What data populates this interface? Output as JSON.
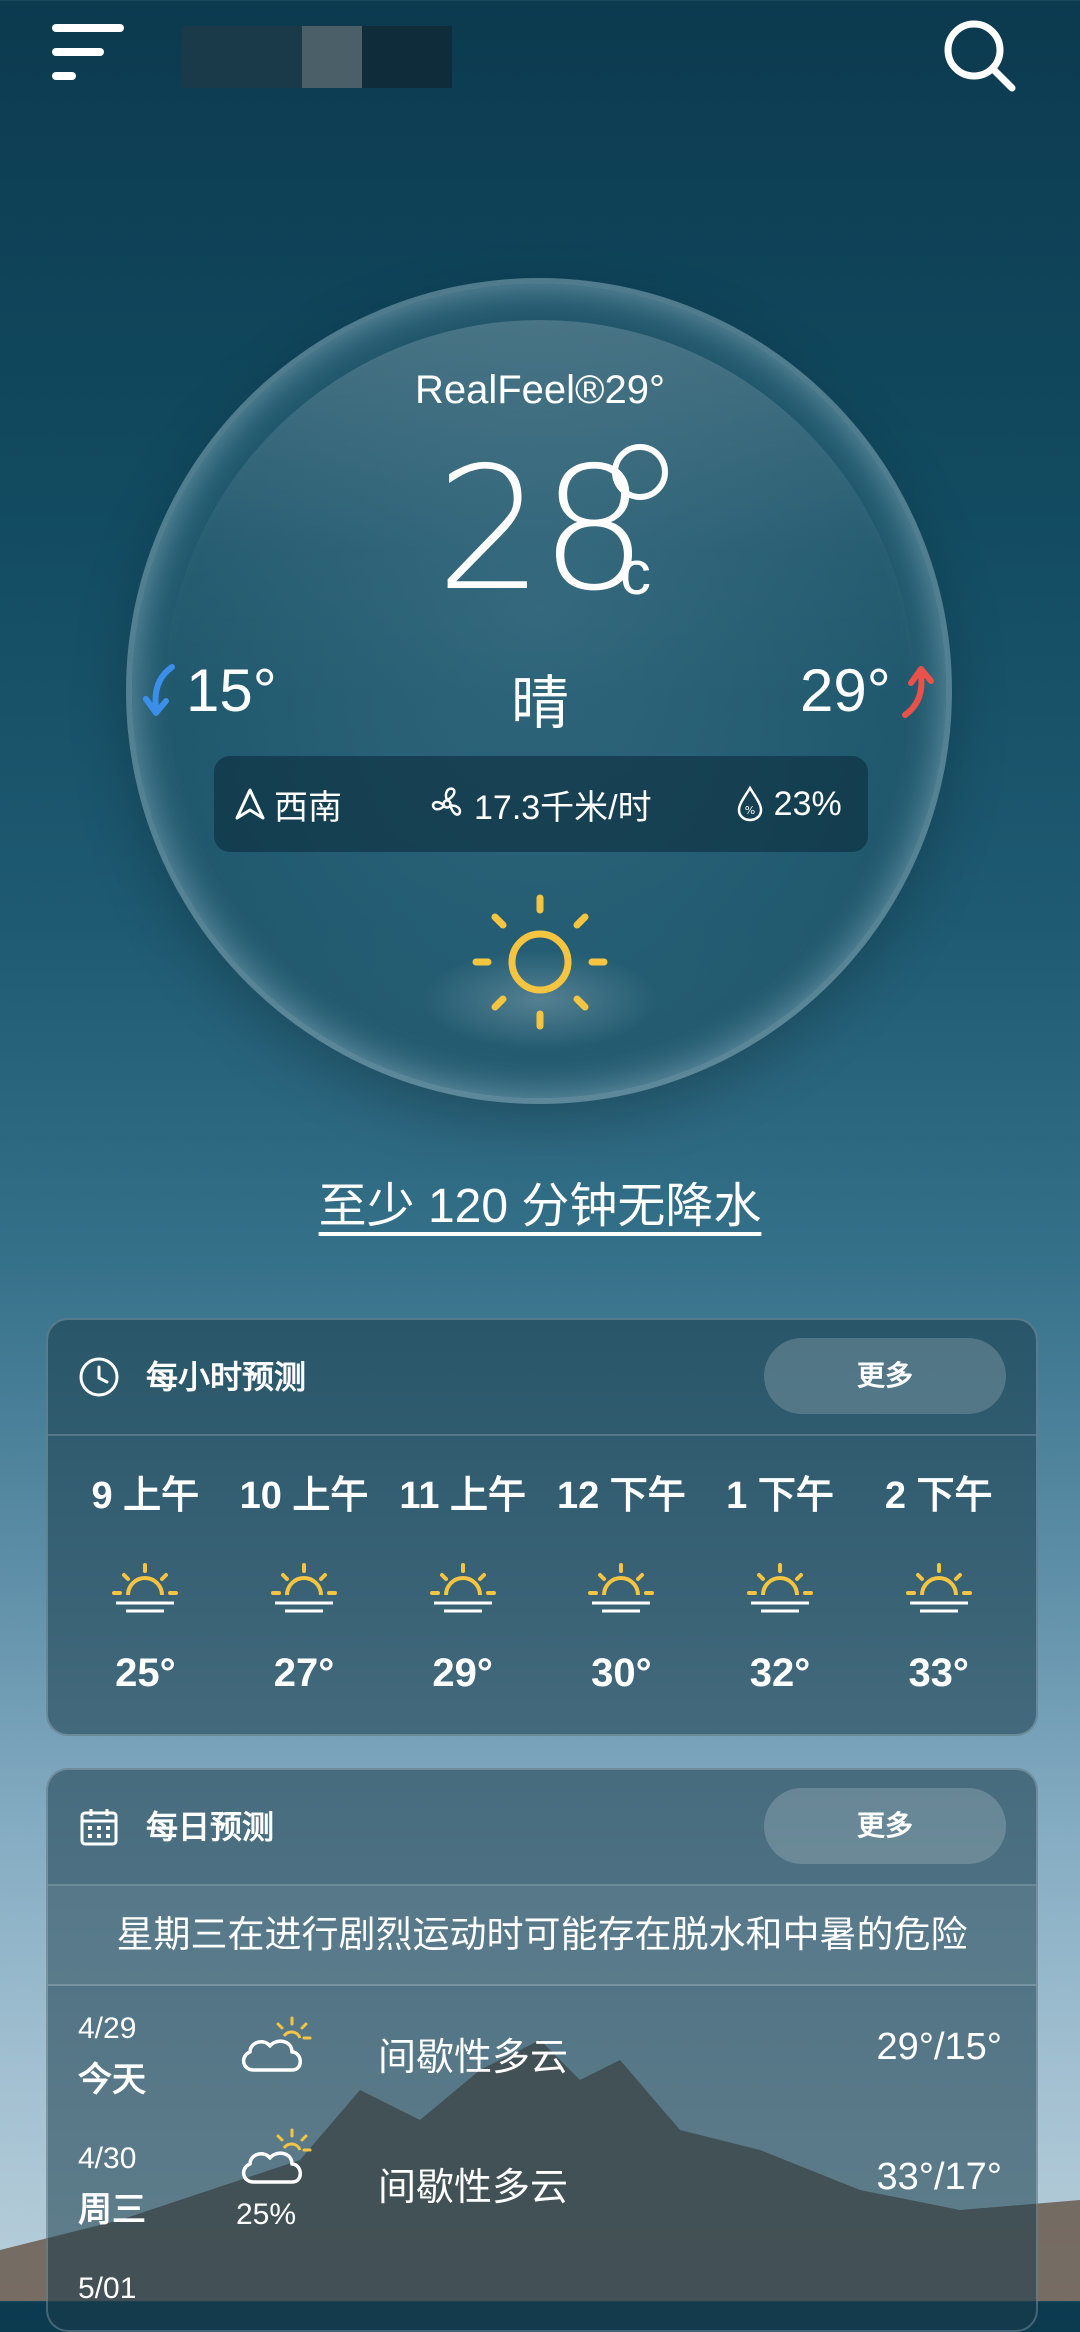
{
  "header": {
    "location_name": "",
    "menu_icon": "menu-icon",
    "search_icon": "search-icon"
  },
  "current": {
    "realfeel": "RealFeel®29°",
    "temperature": "28",
    "unit": "C",
    "low": "15°",
    "high": "29°",
    "condition": "晴",
    "wind_direction": "西南",
    "wind_speed": "17.3千米/时",
    "humidity": "23%",
    "weather_icon": "sun-icon"
  },
  "precipitation_note": "至少 120 分钟无降水",
  "hourly": {
    "title": "每小时预测",
    "more_label": "更多",
    "hours": [
      {
        "time": "9 上午",
        "temp": "25°",
        "icon": "sunrise-icon"
      },
      {
        "time": "10 上午",
        "temp": "27°",
        "icon": "sunrise-icon"
      },
      {
        "time": "11 上午",
        "temp": "29°",
        "icon": "sunrise-icon"
      },
      {
        "time": "12 下午",
        "temp": "30°",
        "icon": "sunrise-icon"
      },
      {
        "time": "1 下午",
        "temp": "32°",
        "icon": "sunrise-icon"
      },
      {
        "time": "2 下午",
        "temp": "33°",
        "icon": "sunrise-icon"
      }
    ]
  },
  "daily": {
    "title": "每日预测",
    "more_label": "更多",
    "advisory": "星期三在进行剧烈运动时可能存在脱水和中暑的危险",
    "days": [
      {
        "date": "4/29",
        "day": "今天",
        "desc": "间歇性多云",
        "temps": "29°/15°",
        "precip": "",
        "icon": "partly-cloudy-icon"
      },
      {
        "date": "4/30",
        "day": "周三",
        "desc": "间歇性多云",
        "temps": "33°/17°",
        "precip": "25%",
        "icon": "partly-cloudy-icon"
      },
      {
        "date": "5/01",
        "day": "",
        "desc": "",
        "temps": "",
        "precip": "",
        "icon": ""
      }
    ]
  },
  "colors": {
    "low_arrow": "#3b8fe8",
    "high_arrow": "#e8524a",
    "sun": "#f5c542"
  }
}
